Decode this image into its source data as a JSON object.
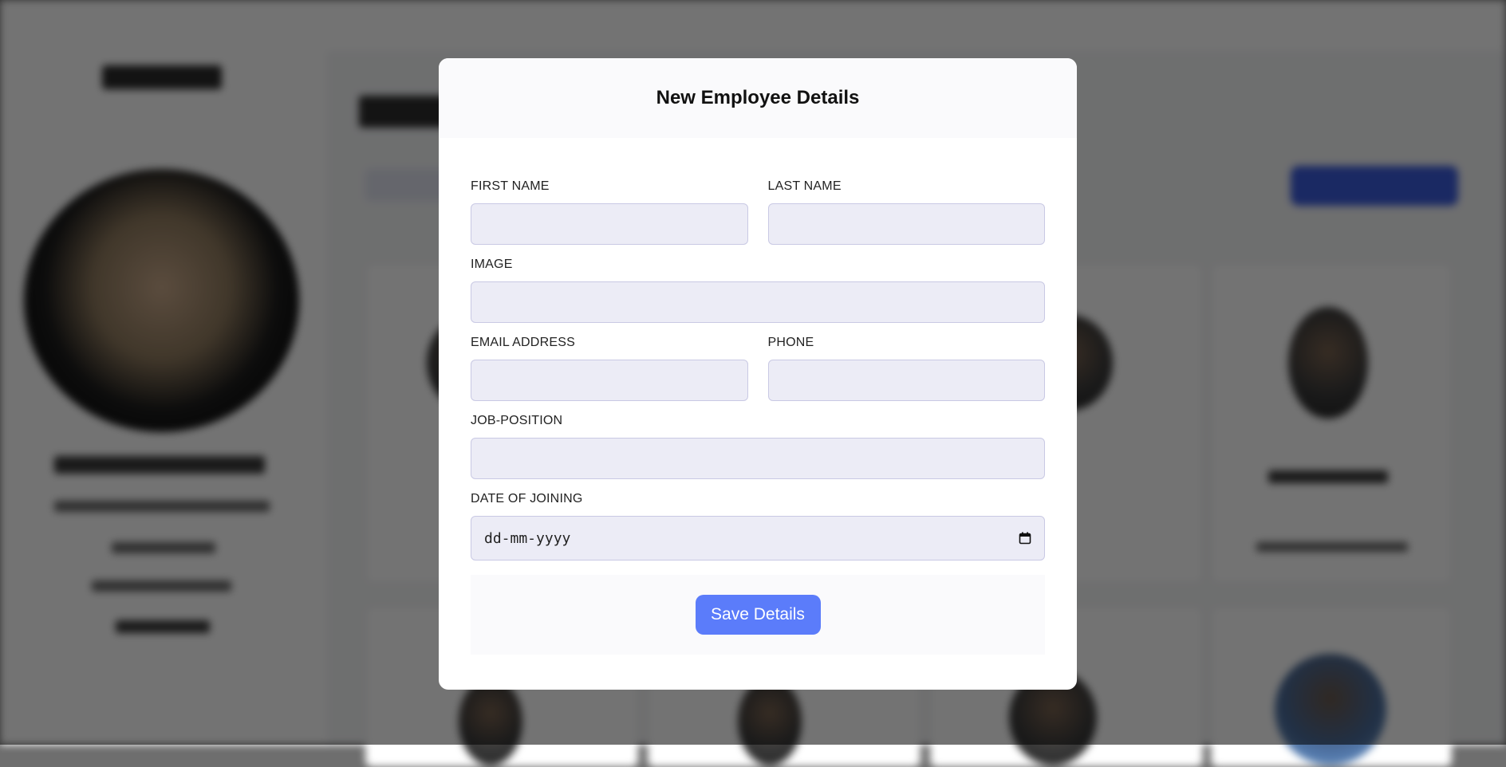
{
  "modal": {
    "title": "New Employee Details",
    "fields": {
      "first_name": {
        "label": "FIRST NAME",
        "value": ""
      },
      "last_name": {
        "label": "LAST NAME",
        "value": ""
      },
      "image": {
        "label": "IMAGE",
        "value": ""
      },
      "email": {
        "label": "EMAIL ADDRESS",
        "value": ""
      },
      "phone": {
        "label": "PHONE",
        "value": ""
      },
      "job_position": {
        "label": "JOB-POSITION",
        "value": ""
      },
      "date_of_joining": {
        "label": "DATE OF JOINING",
        "placeholder": "dd-mm-yyyy"
      }
    },
    "save_label": "Save Details"
  },
  "colors": {
    "accent": "#5b7cfa",
    "input_bg": "#ececf6",
    "input_border": "#c9c9e4",
    "overlay": "#6e6e6e"
  },
  "icons": {
    "date_picker": "calendar-icon"
  }
}
